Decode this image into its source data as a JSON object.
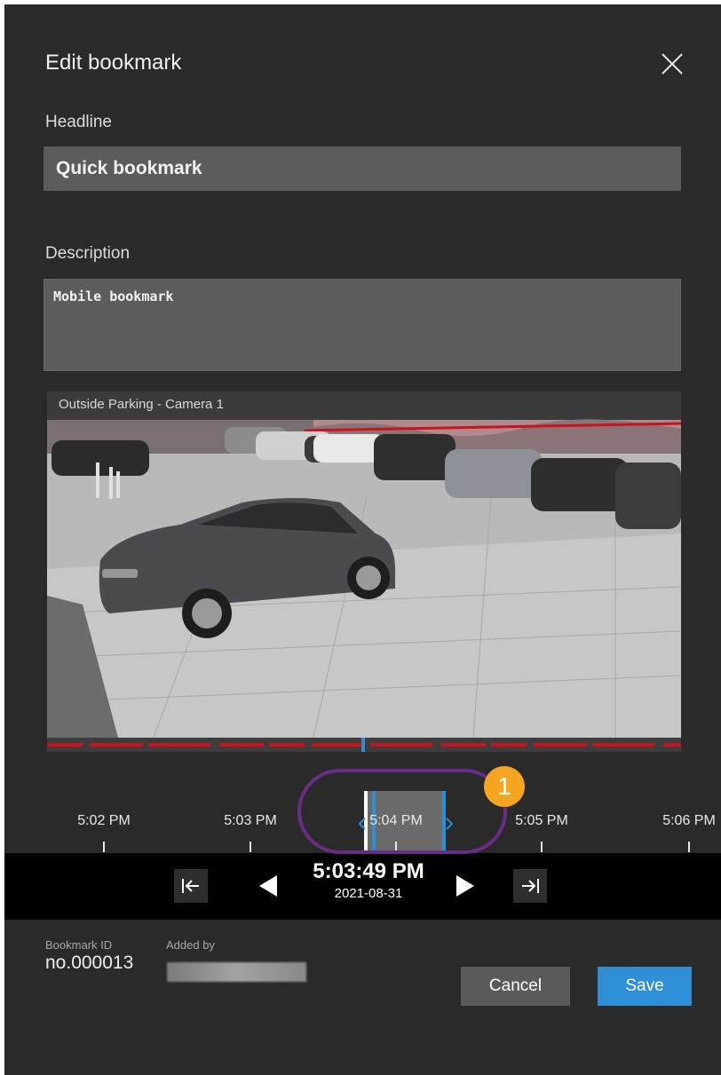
{
  "dialog": {
    "title": "Edit bookmark",
    "close_icon": "close-icon"
  },
  "form": {
    "headline_label": "Headline",
    "headline_value": "Quick bookmark",
    "description_label": "Description",
    "description_value": "Mobile bookmark"
  },
  "video": {
    "camera_title": "Outside Parking - Camera 1"
  },
  "timeline": {
    "ticks": [
      "5:02 PM",
      "5:03 PM",
      "5:04 PM",
      "5:05 PM",
      "5:06 PM"
    ]
  },
  "playback": {
    "time": "5:03:49 PM",
    "date": "2021-08-31",
    "icons": [
      "jump-to-start-icon",
      "previous-icon",
      "next-icon",
      "jump-to-end-icon"
    ]
  },
  "meta": {
    "bookmark_id_label": "Bookmark ID",
    "bookmark_id_value": "no.000013",
    "added_by_label": "Added by"
  },
  "actions": {
    "cancel_label": "Cancel",
    "save_label": "Save"
  },
  "annotation": {
    "badge_number": "1",
    "highlight_color": "#6a2d86",
    "badge_color": "#f4a623"
  },
  "colors": {
    "accent": "#2f8fd6",
    "background": "#2a2a2a",
    "recording_line": "#d0101c"
  }
}
